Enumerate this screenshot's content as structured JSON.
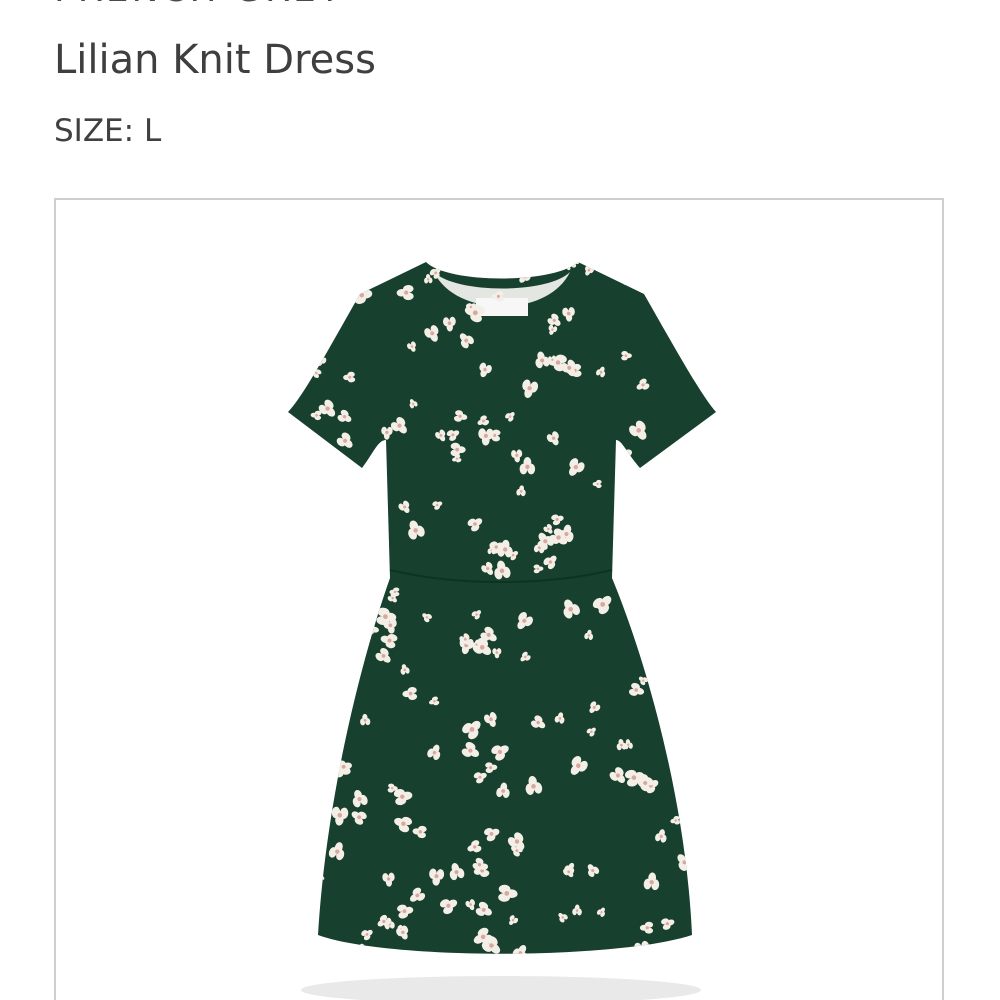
{
  "product": {
    "brand": "FRENCH GREY",
    "name": "Lilian Knit Dress",
    "size_label": "SIZE: L"
  },
  "photo": {
    "subject": "dress-image",
    "dress_color": "#18402e",
    "print_color": "#f4efe6",
    "print_accent": "#d9a7a0"
  }
}
